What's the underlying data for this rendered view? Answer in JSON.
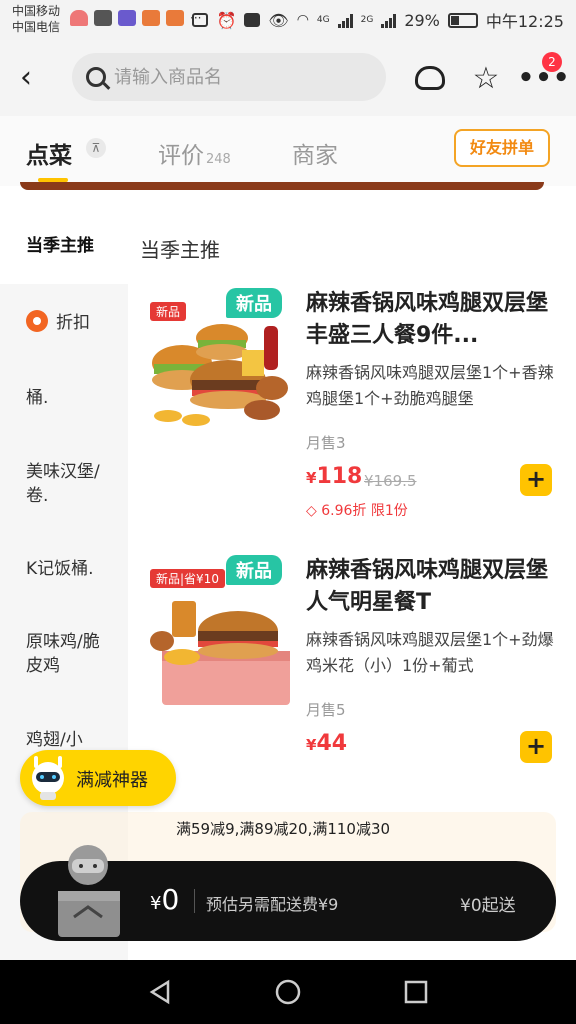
{
  "status_bar": {
    "carrier_1": "中国移动",
    "carrier_2": "中国电信",
    "net_4g": "4G",
    "net_2g": "2G",
    "battery": "29%",
    "time": "中午12:25"
  },
  "topbar": {
    "search_placeholder": "请输入商品名",
    "more_badge": "2"
  },
  "tabs": {
    "order": "点菜",
    "review": "评价",
    "review_count": "248",
    "shop": "商家",
    "group_button": "好友拼单"
  },
  "categories": [
    {
      "label": "当季主推",
      "active": true
    },
    {
      "label": "折扣",
      "icon": "discount-icon"
    },
    {
      "label": "桶."
    },
    {
      "label": "美味汉堡/卷."
    },
    {
      "label": "K记饭桶."
    },
    {
      "label": "原味鸡/脆皮鸡"
    },
    {
      "label": "鸡翅/小"
    }
  ],
  "main": {
    "section_title": "当季主推",
    "products": [
      {
        "name": "麻辣香锅风味鸡腿双层堡丰盛三人餐9件...",
        "desc": "麻辣香锅风味鸡腿双层堡1个+香辣鸡腿堡1个+劲脆鸡腿堡",
        "tag_small": "新品",
        "tag_big": "新品",
        "sold": "月售3",
        "currency": "¥",
        "price": "118",
        "original_price": "¥169.5",
        "discount": "6.96折 限1份"
      },
      {
        "name": "麻辣香锅风味鸡腿双层堡人气明星餐T",
        "desc": "麻辣香锅风味鸡腿双层堡1个+劲爆鸡米花（小）1份+葡式",
        "tag_small": "新品|省¥10",
        "tag_big": "新品",
        "sold": "月售5",
        "currency": "¥",
        "price": "44"
      }
    ]
  },
  "promo": {
    "coupon_label": "满减神器",
    "rules": "满59减9,满89减20,满110减30"
  },
  "cart": {
    "currency": "¥",
    "amount": "0",
    "delivery_fee": "预估另需配送费¥9",
    "min_order": "¥0起送"
  },
  "colors": {
    "accent": "#ffc300",
    "price": "#f0393c",
    "new_tag": "#27c5a4",
    "orange": "#f28a12"
  }
}
